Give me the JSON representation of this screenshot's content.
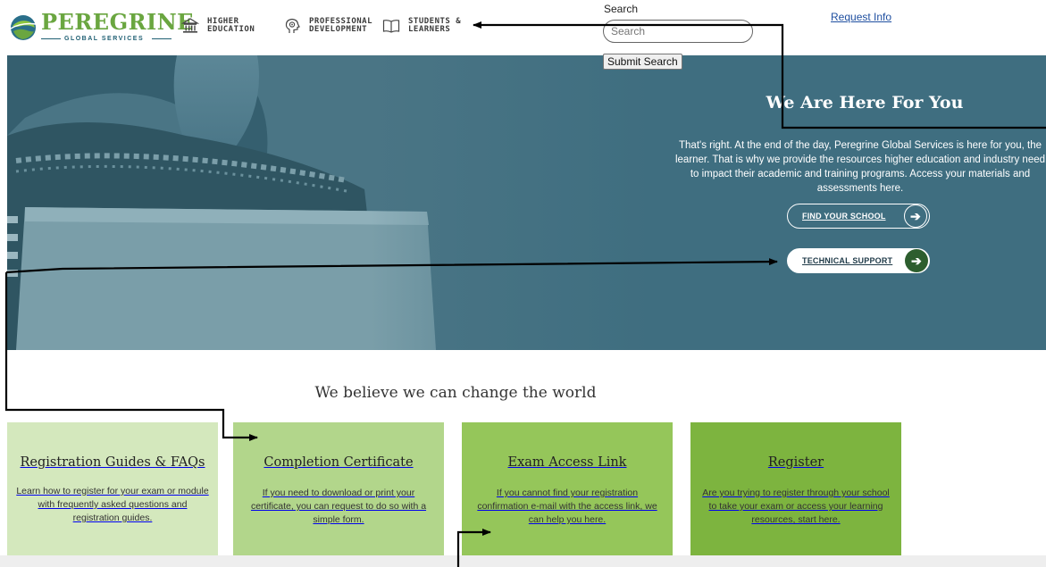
{
  "header": {
    "logo": {
      "name": "PEREGRINE",
      "tagline": "GLOBAL SERVICES"
    },
    "nav": [
      {
        "label": "HIGHER\nEDUCATION",
        "icon": "building-columns-icon"
      },
      {
        "label": "PROFESSIONAL\nDEVELOPMENT",
        "icon": "head-gear-icon"
      },
      {
        "label": "STUDENTS &\nLEARNERS",
        "icon": "open-book-icon"
      }
    ],
    "search": {
      "label": "Search",
      "placeholder": "Search",
      "submit_label": "Submit Search"
    },
    "request_info": "Request Info"
  },
  "hero": {
    "title": "We Are Here For You",
    "body": "That's right. At the end of the day, Peregrine Global Services is here for you, the learner. That is why we provide the resources higher education and industry need to impact their academic and training programs. Access your materials and assessments here.",
    "buttons": [
      {
        "label": "FIND YOUR SCHOOL",
        "icon": "arrow-right-icon"
      },
      {
        "label": "TECHNICAL SUPPORT",
        "icon": "arrow-right-icon"
      }
    ]
  },
  "tagline": "We believe we can change the world",
  "cards": [
    {
      "title": "Registration Guides & FAQs",
      "body": "Learn how to register for your exam or module with frequently asked questions and registration guides."
    },
    {
      "title": "Completion Certificate",
      "body": "If you need to download or print your certificate, you can request to do so with a simple form."
    },
    {
      "title": "Exam Access Link",
      "body": "If you cannot find your registration confirmation e-mail with the access link, we can help you here."
    },
    {
      "title": "Register",
      "body": "Are you trying to register through your school to take your exam or access your learning resources, start here."
    }
  ],
  "colors": {
    "brand_green": "#6aa640",
    "hero_teal": "#3f6e80",
    "accent_rule": "#8cc63f",
    "card_1": "#d4e8bd",
    "card_2": "#b2d68b",
    "card_3": "#95c65a",
    "card_4": "#7db43f"
  }
}
